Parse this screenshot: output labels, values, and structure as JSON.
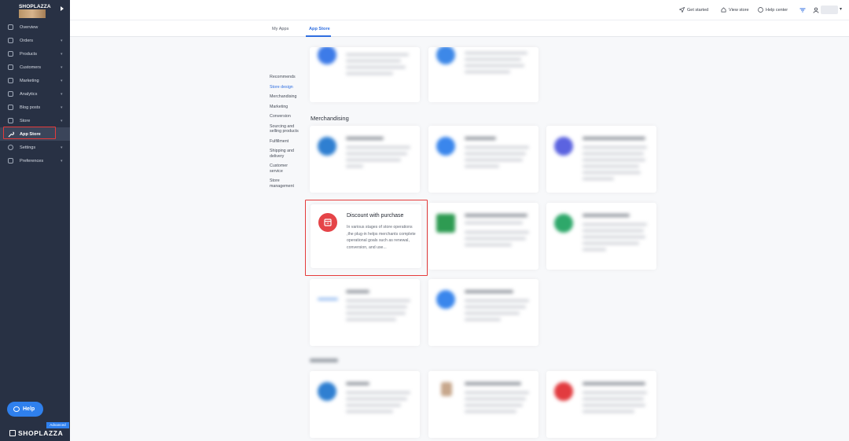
{
  "sidebar": {
    "store_name": "SHOPLAZZA",
    "items": [
      {
        "label": "Overview",
        "icon": "overview-icon",
        "chevron": false
      },
      {
        "label": "Orders",
        "icon": "orders-icon",
        "chevron": true
      },
      {
        "label": "Products",
        "icon": "products-icon",
        "chevron": true
      },
      {
        "label": "Customers",
        "icon": "customers-icon",
        "chevron": true
      },
      {
        "label": "Marketing",
        "icon": "marketing-icon",
        "chevron": true
      },
      {
        "label": "Analytics",
        "icon": "analytics-icon",
        "chevron": true
      },
      {
        "label": "Blog posts",
        "icon": "blog-icon",
        "chevron": true
      },
      {
        "label": "Store",
        "icon": "store-icon",
        "chevron": true
      },
      {
        "label": "App Store",
        "icon": "wrench-icon",
        "chevron": false,
        "active": true
      },
      {
        "label": "Settings",
        "icon": "settings-icon",
        "chevron": true
      },
      {
        "label": "Preferences",
        "icon": "preferences-icon",
        "chevron": true
      }
    ],
    "help_label": "Help",
    "plan_badge": "Advanced",
    "brand": "SHOPLAZZA"
  },
  "topbar": {
    "get_started": "Get started",
    "view_store": "View store",
    "help_center": "Help center"
  },
  "tabs": [
    {
      "label": "My Apps"
    },
    {
      "label": "App Store",
      "active": true
    }
  ],
  "categories": [
    "Recommends",
    "Store design",
    "Merchandising",
    "Marketing",
    "Conversion",
    "Sourcing and selling products",
    "Fulfillment",
    "Shipping and delivery",
    "Customer service",
    "Store management"
  ],
  "active_category": "Store design",
  "section_merchandising": "Merchandising",
  "featured_app": {
    "title": "Discount with purchase",
    "description": "In various stages of store operations ,the plug-in helps merchants complete operational goals such as renewal, conversion, and use..."
  },
  "colors": {
    "sidebar_bg": "#283144",
    "accent": "#2f6ee0",
    "highlight": "#e53b3b",
    "featured_icon": "#e54448"
  }
}
